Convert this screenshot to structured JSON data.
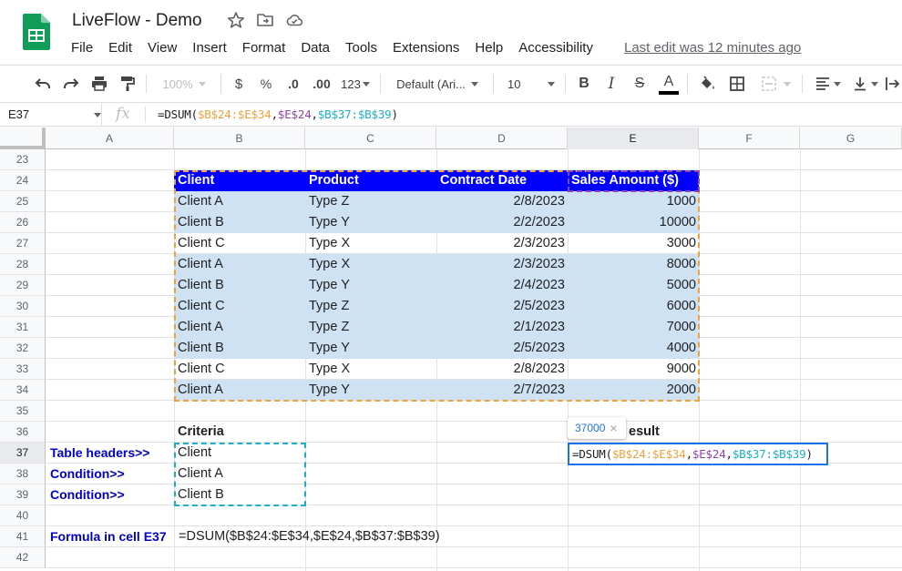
{
  "app": {
    "title": "LiveFlow - Demo",
    "menu": [
      "File",
      "Edit",
      "View",
      "Insert",
      "Format",
      "Data",
      "Tools",
      "Extensions",
      "Help",
      "Accessibility"
    ],
    "last_edit": "Last edit was 12 minutes ago",
    "brand_color": "#0f9d58"
  },
  "toolbar": {
    "zoom": "100%",
    "currency": "$",
    "percent": "%",
    "dec_decrease": ".0",
    "dec_increase": ".00",
    "more_formats": "123",
    "font": "Default (Ari...",
    "font_size": "10",
    "bold": "B",
    "italic": "I",
    "strike": "S",
    "text_color": "A"
  },
  "formula_bar": {
    "cell_ref": "E37",
    "fx": "fx",
    "formula": {
      "prefix": "=DSUM(",
      "range1": "$B$24:$E$34",
      "comma1": ",",
      "field": "$E$24",
      "comma2": ",",
      "criteria": "$B$37:$B$39",
      "suffix": ")"
    }
  },
  "grid": {
    "columns": [
      "A",
      "B",
      "C",
      "D",
      "E",
      "F",
      "G"
    ],
    "active_column": "E",
    "rows": [
      "23",
      "24",
      "25",
      "26",
      "27",
      "28",
      "29",
      "30",
      "31",
      "32",
      "33",
      "34",
      "35",
      "36",
      "37",
      "38",
      "39",
      "40",
      "41",
      "42"
    ],
    "active_row": "37",
    "table": {
      "headers": [
        "Client",
        "Product",
        "Contract Date",
        "Sales Amount ($)"
      ],
      "rows": [
        [
          "Client A",
          "Type Z",
          "2/8/2023",
          "1000"
        ],
        [
          "Client B",
          "Type Y",
          "2/2/2023",
          "10000"
        ],
        [
          "Client C",
          "Type X",
          "2/3/2023",
          "3000"
        ],
        [
          "Client A",
          "Type X",
          "2/3/2023",
          "8000"
        ],
        [
          "Client B",
          "Type Y",
          "2/4/2023",
          "5000"
        ],
        [
          "Client C",
          "Type Z",
          "2/5/2023",
          "6000"
        ],
        [
          "Client A",
          "Type Z",
          "2/1/2023",
          "7000"
        ],
        [
          "Client B",
          "Type Y",
          "2/5/2023",
          "4000"
        ],
        [
          "Client C",
          "Type X",
          "2/8/2023",
          "9000"
        ],
        [
          "Client A",
          "Type Y",
          "2/7/2023",
          "2000"
        ]
      ]
    },
    "criteria": {
      "heading": "Criteria",
      "values": [
        "Client",
        "Client A",
        "Client B"
      ]
    },
    "labels": {
      "table_headers": "Table headers>>",
      "condition1": "Condition>>",
      "condition2": "Condition>>",
      "formula_in_cell": "Formula in cell E37",
      "formula_text": "=DSUM($B$24:$E$34,$E$24,$B$37:$B$39)"
    },
    "result_heading_partial": "esult",
    "tooltip_value": "37000",
    "tooltip_close": "×"
  },
  "colors": {
    "header_fill": "#0000ff",
    "band_fill": "#cfe2f3",
    "label_blue": "#0000cc",
    "range_orange": "#f0a13c",
    "field_purple": "#8e44ad",
    "criteria_teal": "#1ab0c8",
    "selection_blue": "#1a73e8"
  }
}
